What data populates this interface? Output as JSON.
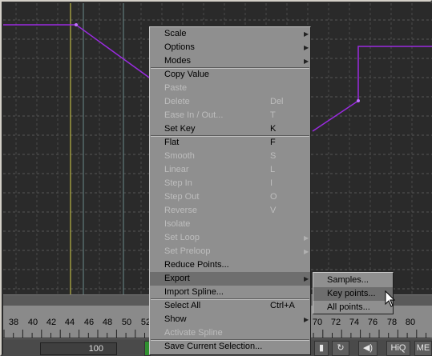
{
  "curve_editor": {
    "ruler_ticks": [
      "38",
      "40",
      "42",
      "44",
      "46",
      "48",
      "50",
      "52",
      "70",
      "72",
      "74",
      "76",
      "78",
      "80"
    ],
    "frame_value": "100",
    "status_buttons": {
      "hiq": "HiQ",
      "me": "ME"
    }
  },
  "context_menu": {
    "items": [
      {
        "label": "Scale",
        "shortcut": "",
        "submenu": true,
        "disabled": false
      },
      {
        "label": "Options",
        "shortcut": "",
        "submenu": true,
        "disabled": false
      },
      {
        "label": "Modes",
        "shortcut": "",
        "submenu": true,
        "disabled": false
      },
      {
        "label": "Copy Value",
        "shortcut": "",
        "submenu": false,
        "disabled": false
      },
      {
        "label": "Paste",
        "shortcut": "",
        "submenu": false,
        "disabled": true
      },
      {
        "label": "Delete",
        "shortcut": "Del",
        "submenu": false,
        "disabled": true
      },
      {
        "label": "Ease In / Out...",
        "shortcut": "T",
        "submenu": false,
        "disabled": true
      },
      {
        "label": "Set Key",
        "shortcut": "K",
        "submenu": false,
        "disabled": false
      },
      {
        "label": "Flat",
        "shortcut": "F",
        "submenu": false,
        "disabled": false
      },
      {
        "label": "Smooth",
        "shortcut": "S",
        "submenu": false,
        "disabled": true
      },
      {
        "label": "Linear",
        "shortcut": "L",
        "submenu": false,
        "disabled": true
      },
      {
        "label": "Step In",
        "shortcut": "I",
        "submenu": false,
        "disabled": true
      },
      {
        "label": "Step Out",
        "shortcut": "O",
        "submenu": false,
        "disabled": true
      },
      {
        "label": "Reverse",
        "shortcut": "V",
        "submenu": false,
        "disabled": true
      },
      {
        "label": "Isolate",
        "shortcut": "",
        "submenu": false,
        "disabled": true
      },
      {
        "label": "Set Loop",
        "shortcut": "",
        "submenu": true,
        "disabled": true
      },
      {
        "label": "Set Preloop",
        "shortcut": "",
        "submenu": true,
        "disabled": true
      },
      {
        "label": "Reduce Points...",
        "shortcut": "",
        "submenu": false,
        "disabled": false
      },
      {
        "label": "Export",
        "shortcut": "",
        "submenu": true,
        "disabled": false,
        "highlighted": true
      },
      {
        "label": "Import Spline...",
        "shortcut": "",
        "submenu": false,
        "disabled": false
      },
      {
        "label": "Select All",
        "shortcut": "Ctrl+A",
        "submenu": false,
        "disabled": false
      },
      {
        "label": "Show",
        "shortcut": "",
        "submenu": true,
        "disabled": false
      },
      {
        "label": "Activate Spline",
        "shortcut": "",
        "submenu": false,
        "disabled": true
      },
      {
        "label": "Save Current Selection...",
        "shortcut": "",
        "submenu": false,
        "disabled": false
      }
    ]
  },
  "export_submenu": {
    "items": [
      {
        "label": "Samples...",
        "highlighted": false
      },
      {
        "label": "Key points...",
        "highlighted": true
      },
      {
        "label": "All points...",
        "highlighted": false
      }
    ]
  }
}
